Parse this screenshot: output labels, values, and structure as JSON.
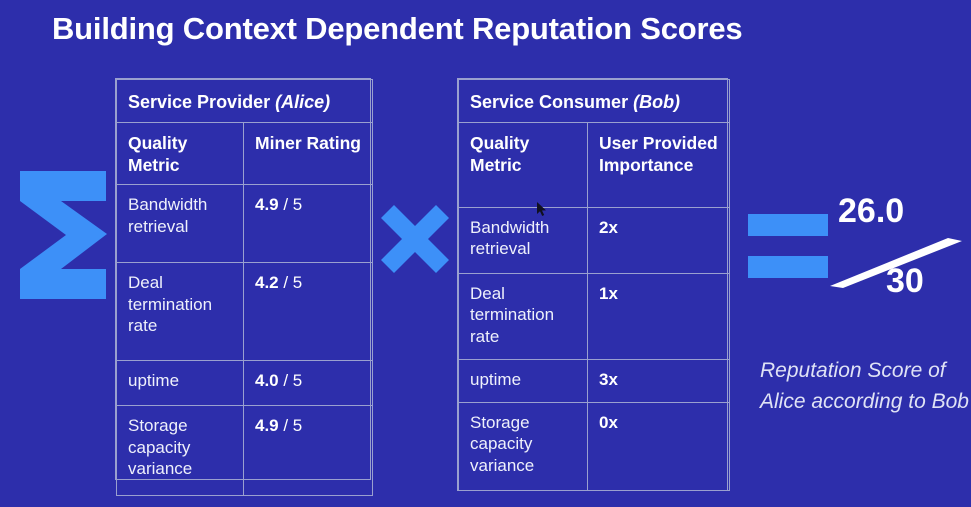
{
  "slide": {
    "title": "Building Context Dependent Reputation Scores",
    "background_color": "#2d2eab",
    "accent_color": "#3d90f8",
    "border_color": "#9aa0cf",
    "text_color": "#ffffff"
  },
  "operators": {
    "sum_symbol": "Σ",
    "sum_icon_name": "sigma-summation-icon",
    "multiply_symbol": "×",
    "multiply_icon_name": "multiplication-cross-icon",
    "equals_symbol": "=",
    "equals_icon_name": "equals-sign-icon"
  },
  "provider_table": {
    "title_main": "Service Provider ",
    "title_who": "(Alice)",
    "columns": [
      "Quality\nMetric",
      "Miner\nRating"
    ],
    "column_1": "Quality Metric",
    "column_2": "Miner Rating",
    "rows": [
      {
        "metric": "Bandwidth retrieval",
        "value": "4.9",
        "suffix": " / 5"
      },
      {
        "metric": "Deal termination rate",
        "value": "4.2",
        "suffix": " / 5"
      },
      {
        "metric": "uptime",
        "value": "4.0",
        "suffix": " / 5"
      },
      {
        "metric": "Storage capacity variance",
        "value": "4.9",
        "suffix": " / 5"
      }
    ]
  },
  "consumer_table": {
    "title_main": "Service Consumer ",
    "title_who": "(Bob)",
    "column_1": "Quality Metric",
    "column_2": "User Provided Importance",
    "rows": [
      {
        "metric": "Bandwidth retrieval",
        "value": "2x"
      },
      {
        "metric": "Deal termination rate",
        "value": "1x"
      },
      {
        "metric": "uptime",
        "value": "3x"
      },
      {
        "metric": "Storage capacity variance",
        "value": "0x"
      }
    ]
  },
  "result": {
    "numerator": "26.0",
    "denominator": "30",
    "caption": "Reputation Score of Alice according to Bob"
  }
}
